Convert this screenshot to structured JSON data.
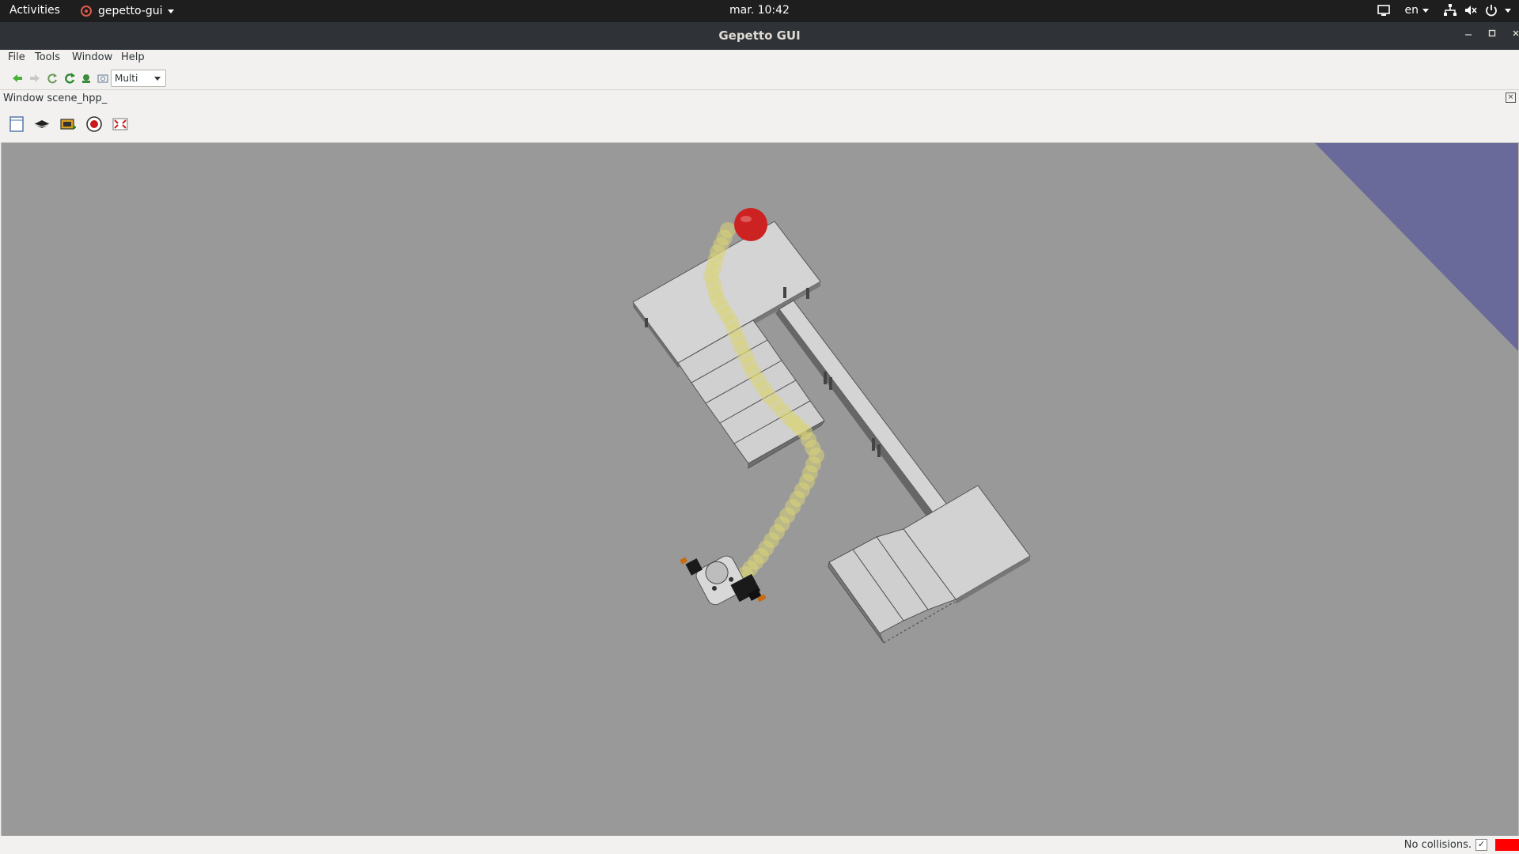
{
  "topbar": {
    "activities": "Activities",
    "app_name": "gepetto-gui",
    "clock": "mar. 10:42",
    "language": "en",
    "icons": [
      "display-icon",
      "network-icon",
      "volume-muted-icon",
      "power-icon"
    ]
  },
  "window": {
    "title": "Gepetto GUI",
    "controls": [
      "minimize",
      "maximize",
      "close"
    ]
  },
  "menubar": {
    "items": [
      "File",
      "Tools",
      "Window",
      "Help"
    ]
  },
  "toolbar": {
    "icons": [
      "back-arrow-icon",
      "forward-arrow-icon",
      "refresh-small-icon",
      "reload-icon",
      "add-body-icon",
      "screenshot-icon"
    ],
    "select_value": "Multi"
  },
  "dock": {
    "title": "Window scene_hpp_",
    "tools": [
      "new-node-icon",
      "camera-icon",
      "capture-icon",
      "record-icon",
      "fit-view-icon"
    ]
  },
  "viewport": {
    "background": "#999999",
    "sky_color": "#6a6a9a",
    "goal_color": "#cc2222",
    "path_color": "#d8d478"
  },
  "status": {
    "message": "No collisions.",
    "check": "✓",
    "indicator_color": "#ff0000"
  },
  "colors": {
    "topbar_bg": "#1e1e1e",
    "titlebar_bg": "#2f3236",
    "panel_bg": "#f2f1f0"
  }
}
